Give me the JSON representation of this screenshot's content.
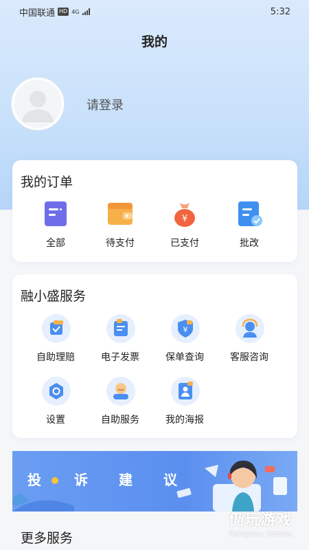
{
  "status_bar": {
    "carrier": "中国联通",
    "hd": "HD",
    "network": "4G",
    "time": "5:32"
  },
  "header": {
    "title": "我的"
  },
  "profile": {
    "login_text": "请登录"
  },
  "orders": {
    "title": "我的订单",
    "items": [
      {
        "label": "全部",
        "icon": "document-list-icon"
      },
      {
        "label": "待支付",
        "icon": "wallet-icon"
      },
      {
        "label": "已支付",
        "icon": "money-bag-icon"
      },
      {
        "label": "批改",
        "icon": "edit-document-icon"
      }
    ]
  },
  "services": {
    "title": "融小盛服务",
    "items": [
      {
        "label": "自助理赔",
        "icon": "claim-icon"
      },
      {
        "label": "电子发票",
        "icon": "invoice-icon"
      },
      {
        "label": "保单查询",
        "icon": "policy-shield-icon"
      },
      {
        "label": "客服咨询",
        "icon": "customer-service-icon"
      },
      {
        "label": "设置",
        "icon": "settings-icon"
      },
      {
        "label": "自助服务",
        "icon": "self-service-icon"
      },
      {
        "label": "我的海报",
        "icon": "poster-icon"
      }
    ]
  },
  "banner": {
    "chars": [
      "投",
      "诉",
      "建",
      "议"
    ]
  },
  "more": {
    "title": "更多服务"
  },
  "watermark": {
    "cn": "仍玩游戏",
    "en": "Rengwan Games"
  },
  "colors": {
    "accent": "#5b8fef",
    "orange": "#f5a33a",
    "hero_bg": "#c9e1fb"
  }
}
